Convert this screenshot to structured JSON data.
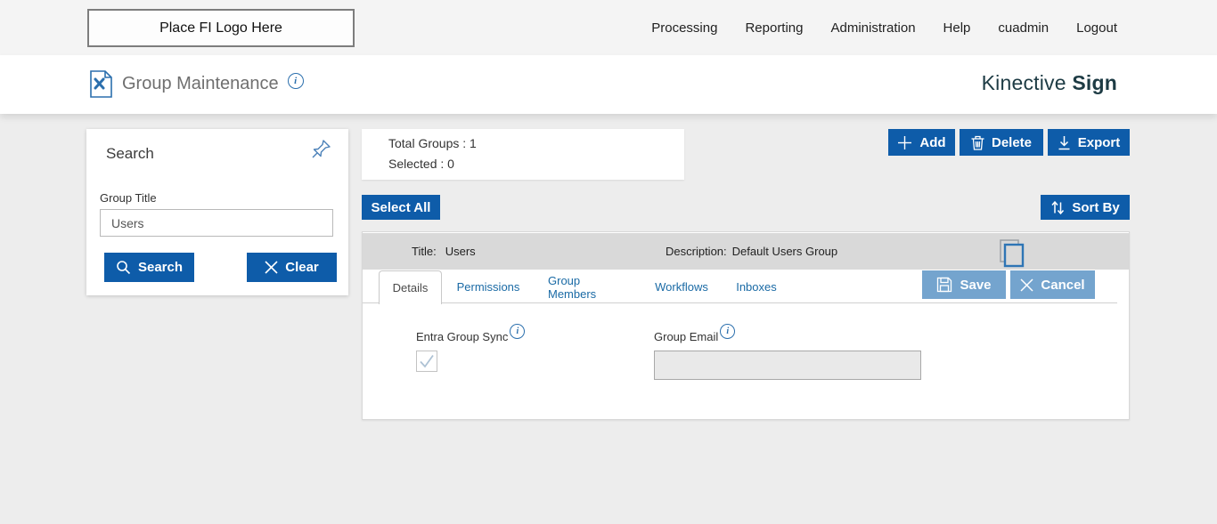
{
  "topbar": {
    "logo_placeholder": "Place FI Logo Here",
    "nav": [
      {
        "label": "Processing"
      },
      {
        "label": "Reporting"
      },
      {
        "label": "Administration"
      },
      {
        "label": "Help"
      },
      {
        "label": "cuadmin"
      },
      {
        "label": "Logout"
      }
    ]
  },
  "header": {
    "page_title": "Group Maintenance",
    "brand_name": "Kinective",
    "brand_product": "Sign"
  },
  "icons": {
    "info_glyph": "i"
  },
  "search_panel": {
    "title": "Search",
    "group_title_label": "Group Title",
    "group_title_value": "Users",
    "search_button": "Search",
    "clear_button": "Clear"
  },
  "summary": {
    "total_groups": "Total Groups : 1",
    "selected": "Selected : 0"
  },
  "actions": {
    "add": "Add",
    "delete": "Delete",
    "export": "Export",
    "select_all": "Select All",
    "sort_by": "Sort By"
  },
  "group": {
    "title_label": "Title:",
    "title_value": "Users",
    "description_label": "Description:",
    "description_value": "Default Users Group"
  },
  "tabs": [
    {
      "label": "Details",
      "active": true
    },
    {
      "label": "Permissions",
      "active": false
    },
    {
      "label": "Group Members",
      "active": false
    },
    {
      "label": "Workflows",
      "active": false
    },
    {
      "label": "Inboxes",
      "active": false
    }
  ],
  "form_actions": {
    "save": "Save",
    "cancel": "Cancel"
  },
  "details_form": {
    "entra_group_sync_label": "Entra Group Sync",
    "entra_group_sync_checked": true,
    "group_email_label": "Group Email",
    "group_email_value": ""
  },
  "colors": {
    "accent_blue": "#0e5ca9",
    "muted_blue": "#74a4ce",
    "link_blue": "#1a6aa5",
    "row_gray": "#d9d9d9",
    "brand_dark": "#1d3b44",
    "page_bg": "#ededed",
    "topbar_bg": "#f4f4f4"
  }
}
